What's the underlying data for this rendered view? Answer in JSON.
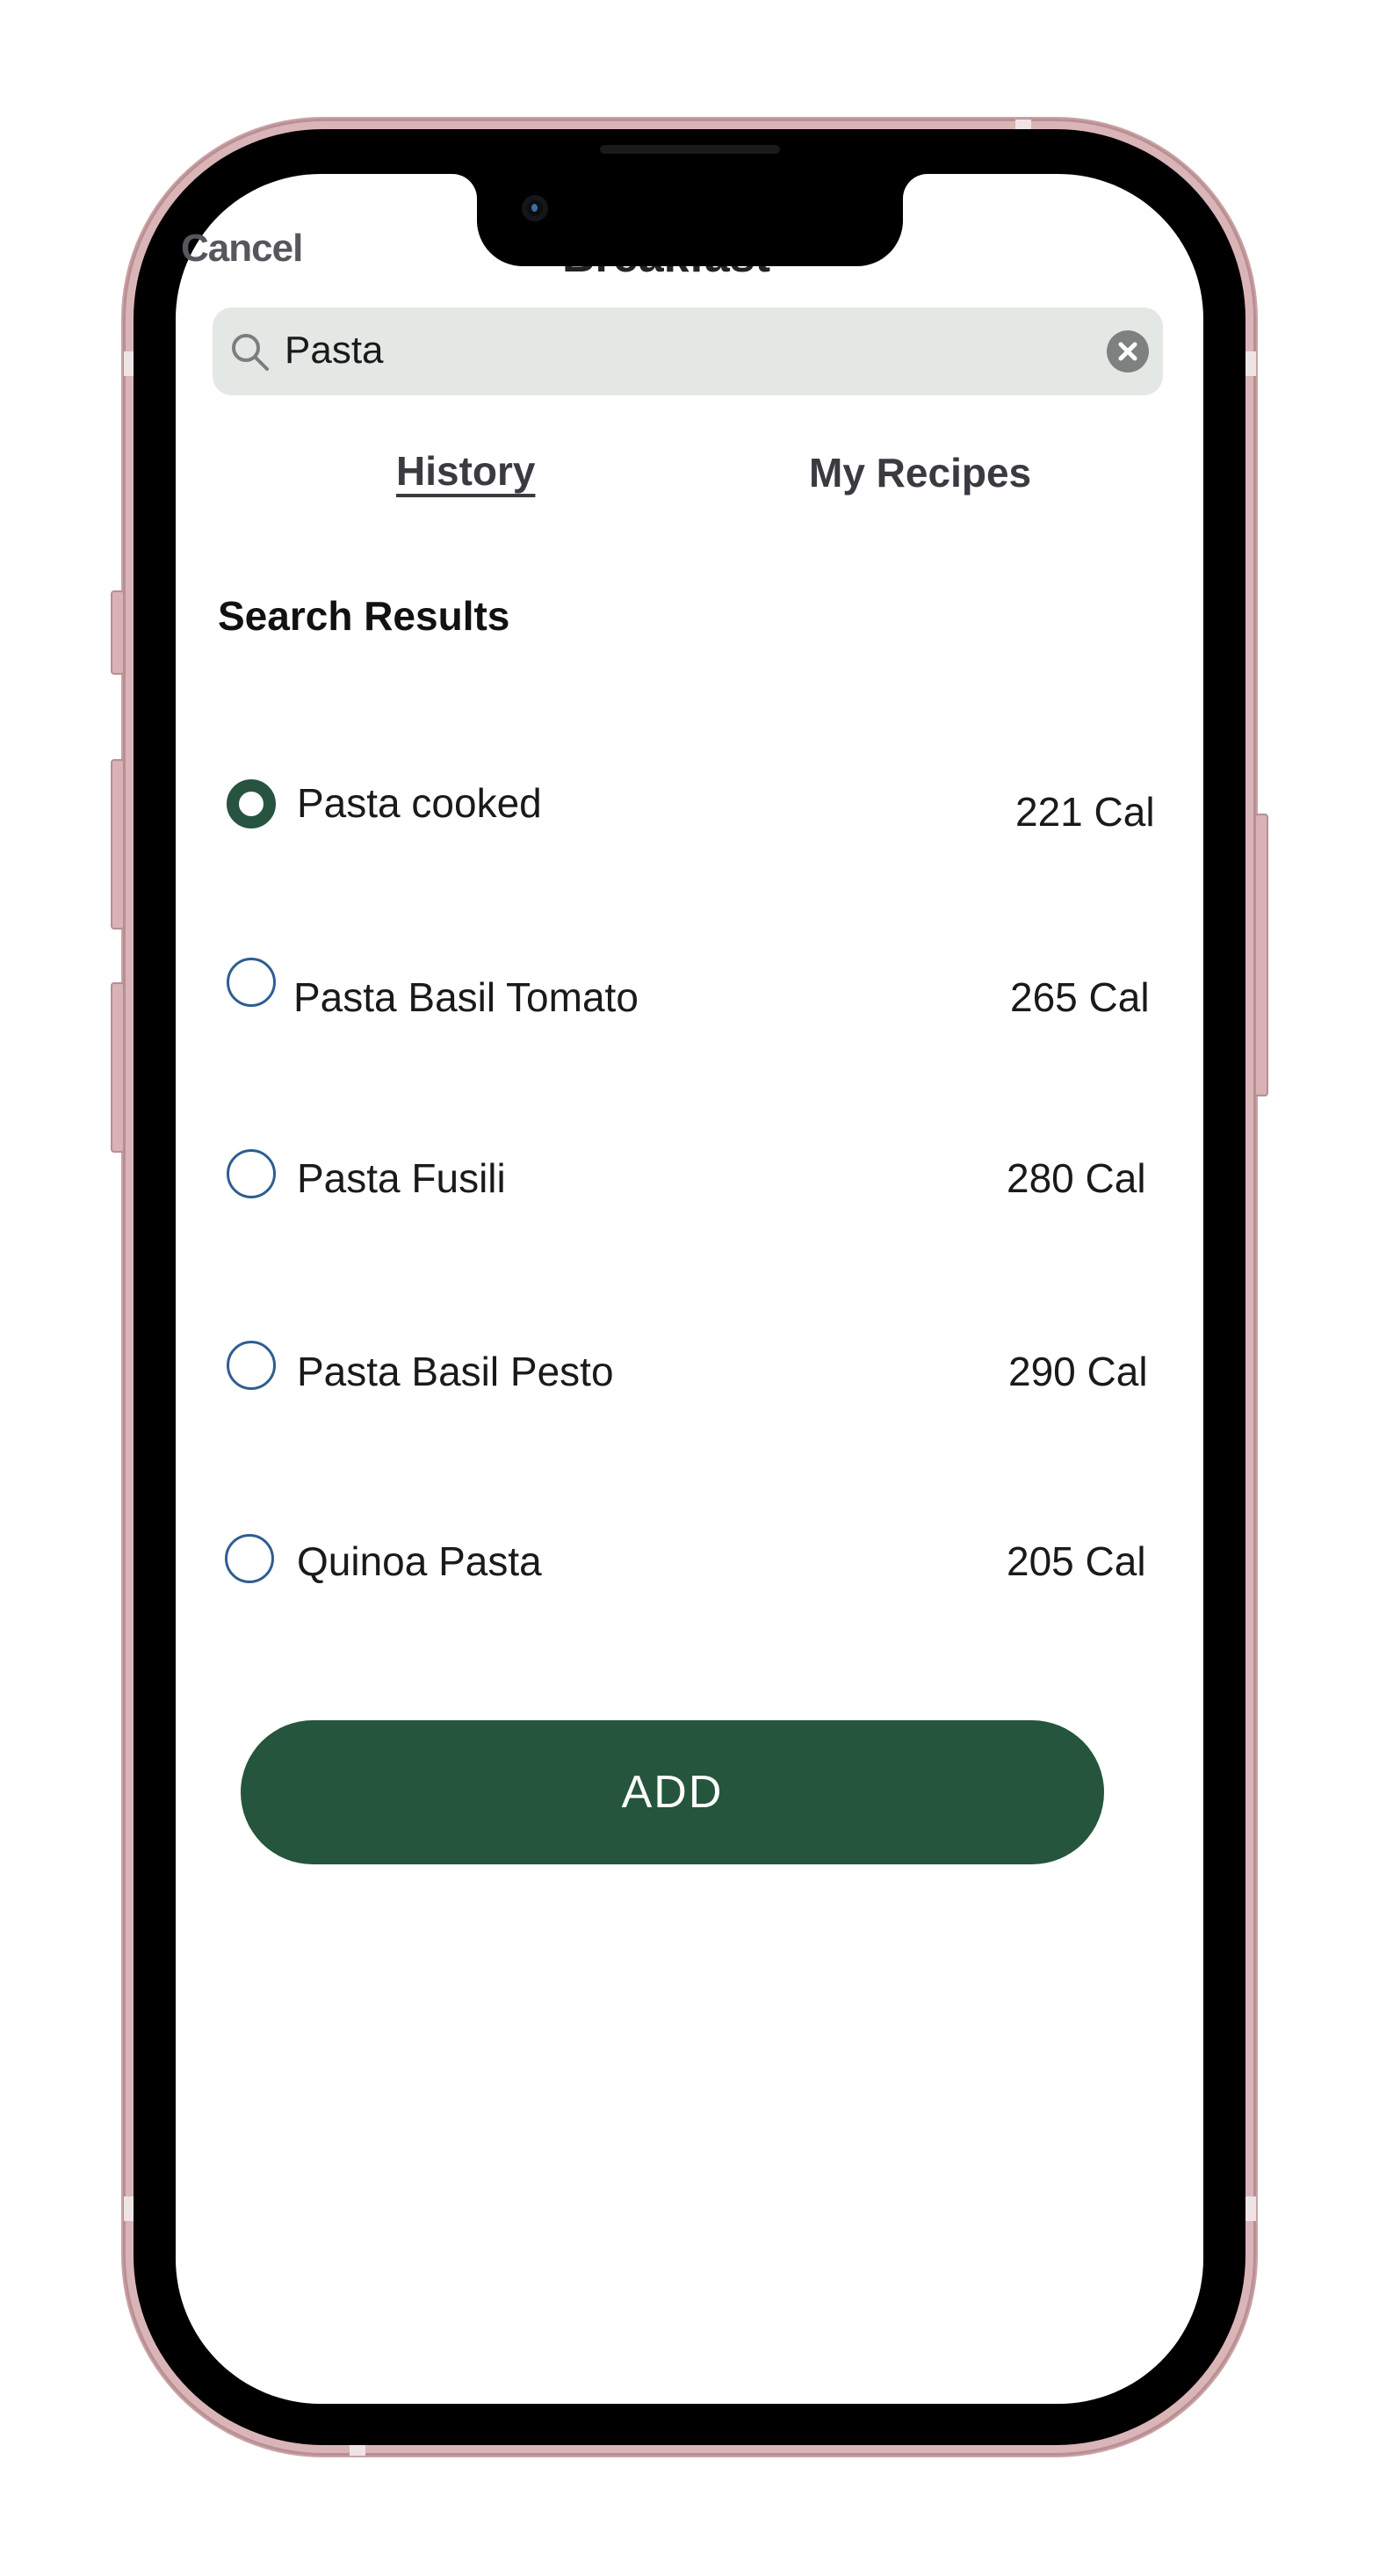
{
  "header": {
    "cancel_label": "Cancel",
    "title": "Breakfast"
  },
  "search": {
    "value": "Pasta",
    "icon": "search-icon",
    "clear_icon": "clear-icon"
  },
  "tabs": [
    {
      "label": "History",
      "active": true
    },
    {
      "label": "My Recipes",
      "active": false
    }
  ],
  "results": {
    "title": "Search Results",
    "items": [
      {
        "name": "Pasta cooked",
        "calories": "221 Cal",
        "selected": true
      },
      {
        "name": "Pasta Basil Tomato",
        "calories": "265 Cal",
        "selected": false
      },
      {
        "name": "Pasta Fusili",
        "calories": "280 Cal",
        "selected": false
      },
      {
        "name": "Pasta Basil Pesto",
        "calories": "290 Cal",
        "selected": false
      },
      {
        "name": "Quinoa Pasta",
        "calories": "205 Cal",
        "selected": false
      }
    ]
  },
  "add_button": {
    "label": "ADD"
  },
  "colors": {
    "primary": "#25553c",
    "radio_outline": "#2e5e91",
    "search_bg": "#e4e8e5"
  }
}
